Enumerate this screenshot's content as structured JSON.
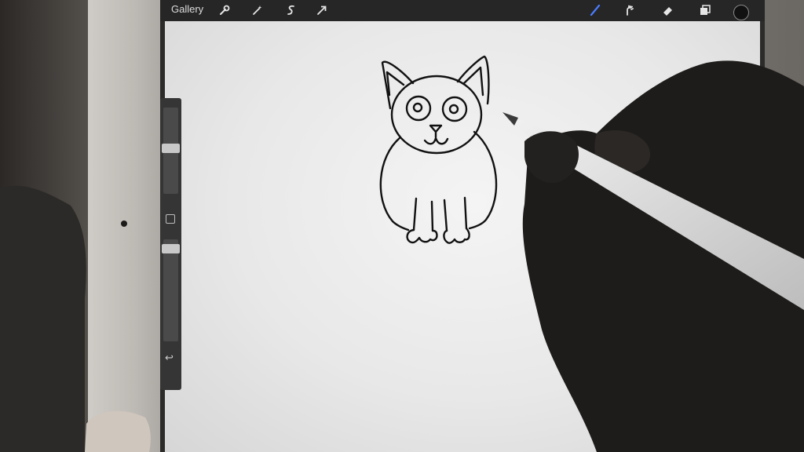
{
  "topbar": {
    "gallery_label": "Gallery",
    "left_tools": [
      "wrench-icon",
      "magic-wand-icon",
      "selection-icon",
      "transform-arrow-icon"
    ],
    "right_tools": [
      "brush-icon",
      "smudge-icon",
      "eraser-icon",
      "layers-icon"
    ],
    "current_color": "#111111"
  },
  "sidebar": {
    "brush_size_slider_icon": "slider",
    "opacity_slider_icon": "slider",
    "modify_button_icon": "square-icon",
    "undo_icon": "undo-arrow-icon"
  },
  "canvas": {
    "drawing": "cat-line-drawing",
    "stroke_color": "#111111"
  },
  "colors": {
    "ui_dark": "#262626",
    "accent": "#4a7dff"
  }
}
